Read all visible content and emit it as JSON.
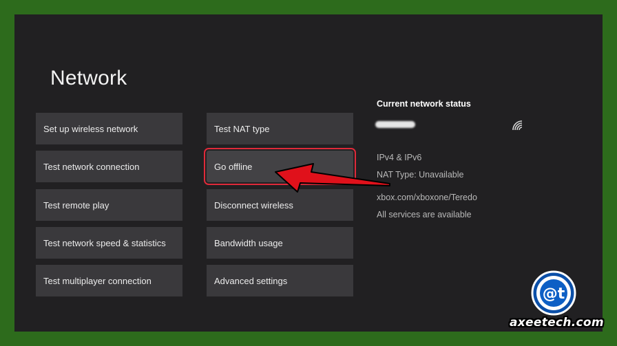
{
  "page": {
    "title": "Network"
  },
  "menu": {
    "left_column": [
      {
        "label": "Set up wireless network"
      },
      {
        "label": "Test network connection"
      },
      {
        "label": "Test remote play"
      },
      {
        "label": "Test network speed & statistics"
      },
      {
        "label": "Test multiplayer connection"
      }
    ],
    "right_column": [
      {
        "label": "Test NAT type"
      },
      {
        "label": "Go offline",
        "selected": true
      },
      {
        "label": "Disconnect wireless"
      },
      {
        "label": "Bandwidth usage"
      },
      {
        "label": "Advanced settings"
      }
    ]
  },
  "status": {
    "title": "Current network status",
    "network_name": "redacted",
    "signal_icon": "wifi-icon",
    "ip_version": "IPv4 & IPv6",
    "nat_type": "NAT Type: Unavailable",
    "teredo": "xbox.com/xboxone/Teredo",
    "services": "All services are available"
  },
  "annotation": {
    "arrow_color": "#e0111b",
    "highlight_color": "#e02a3a"
  },
  "watermark": {
    "text": "axeetech.com",
    "logo_letters": "@t"
  },
  "colors": {
    "border": "#2d6b1c",
    "background": "#212022",
    "tile": "#3a393c"
  }
}
